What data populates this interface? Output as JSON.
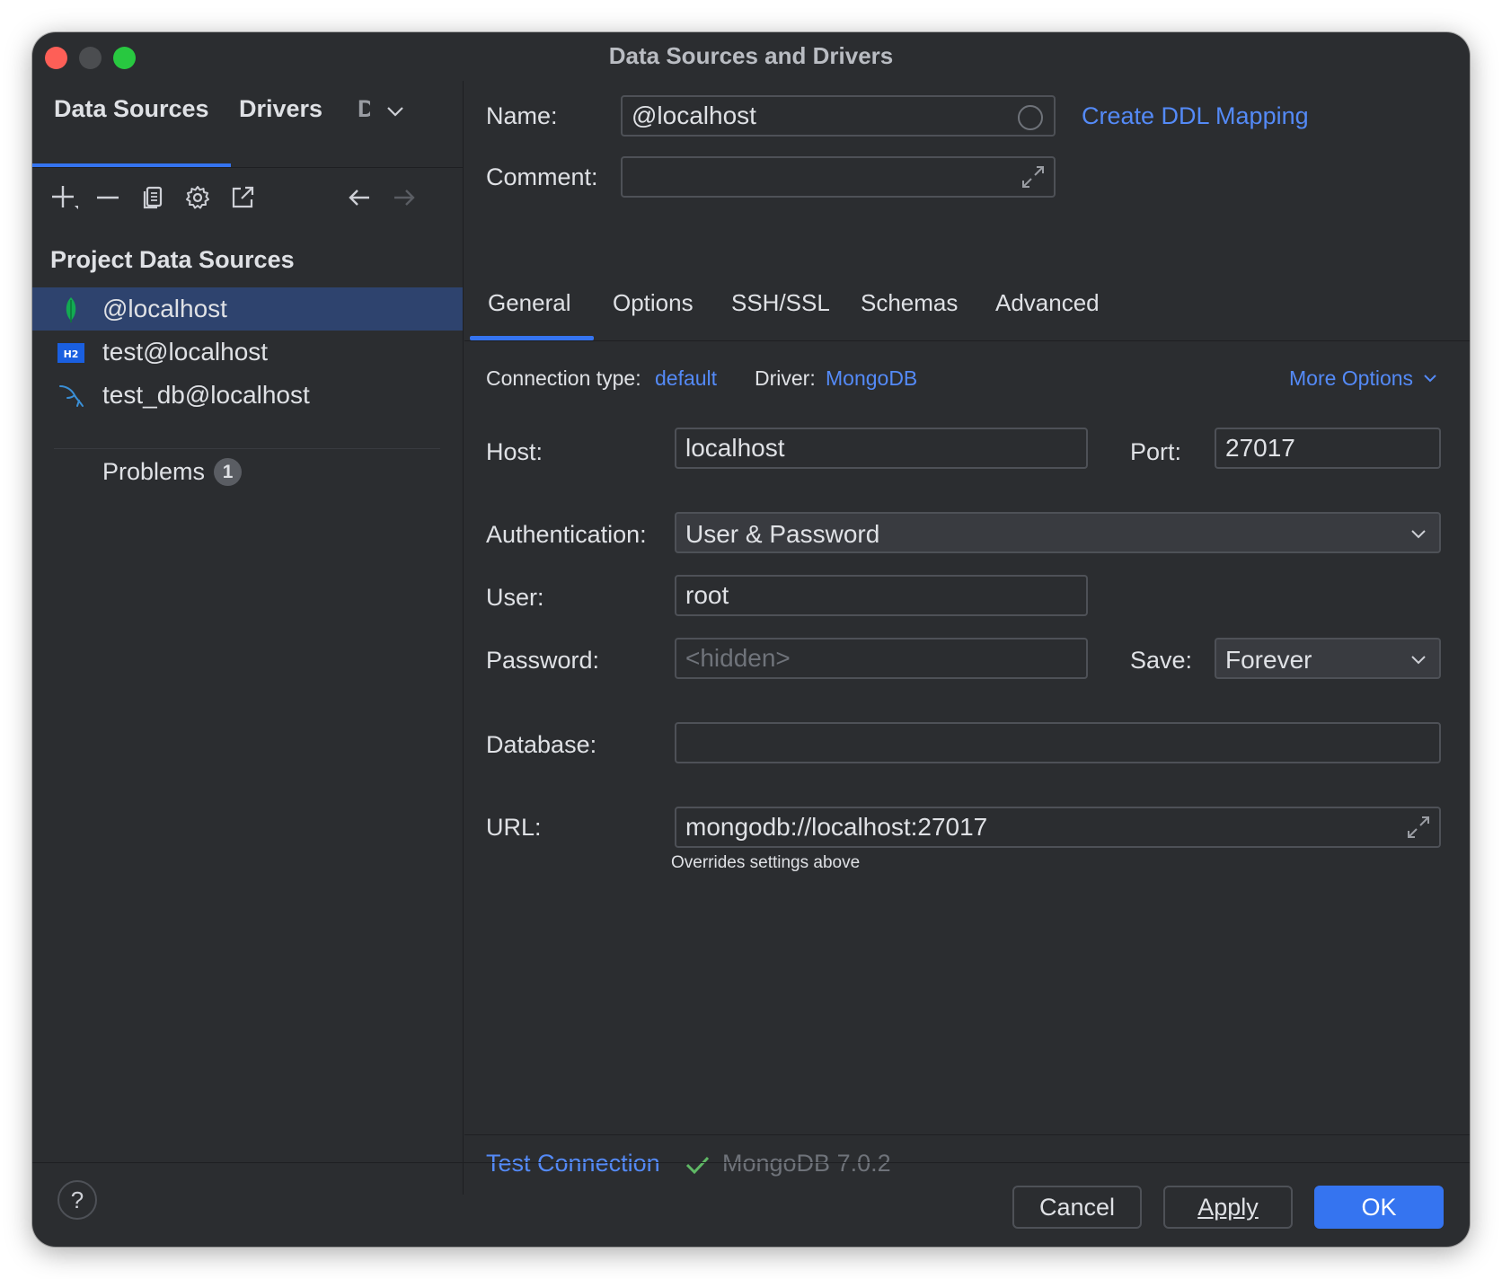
{
  "window": {
    "title": "Data Sources and Drivers"
  },
  "sidebar": {
    "tabs": [
      "Data Sources",
      "Drivers",
      "D"
    ],
    "section_title": "Project Data Sources",
    "items": [
      {
        "label": "@localhost",
        "icon": "mongodb-leaf-icon",
        "selected": true
      },
      {
        "label": "test@localhost",
        "icon": "h2-database-icon",
        "selected": false
      },
      {
        "label": "test_db@localhost",
        "icon": "mysql-dolphin-icon",
        "selected": false
      }
    ],
    "problems": {
      "label": "Problems",
      "count": "1"
    }
  },
  "form": {
    "name_label": "Name:",
    "name_value": "@localhost",
    "ddl_link": "Create DDL Mapping",
    "comment_label": "Comment:",
    "comment_value": "",
    "tabs": [
      "General",
      "Options",
      "SSH/SSL",
      "Schemas",
      "Advanced"
    ],
    "active_tab": "General",
    "connection_type_label": "Connection type:",
    "connection_type_value": "default",
    "driver_label": "Driver:",
    "driver_value": "MongoDB",
    "more_options": "More Options",
    "host_label": "Host:",
    "host_value": "localhost",
    "port_label": "Port:",
    "port_value": "27017",
    "auth_label": "Authentication:",
    "auth_value": "User & Password",
    "user_label": "User:",
    "user_value": "root",
    "password_label": "Password:",
    "password_placeholder": "<hidden>",
    "save_label": "Save:",
    "save_value": "Forever",
    "database_label": "Database:",
    "database_value": "",
    "url_label": "URL:",
    "url_value": "mongodb://localhost:27017",
    "url_hint": "Overrides settings above",
    "test_connection": "Test Connection",
    "test_result": "MongoDB 7.0.2"
  },
  "footer": {
    "help": "?",
    "cancel": "Cancel",
    "apply": "Apply",
    "ok": "OK"
  },
  "colors": {
    "accent": "#3574f0",
    "link": "#548af7",
    "success": "#5fb865",
    "background": "#2b2d30",
    "selection": "#2e436e"
  }
}
